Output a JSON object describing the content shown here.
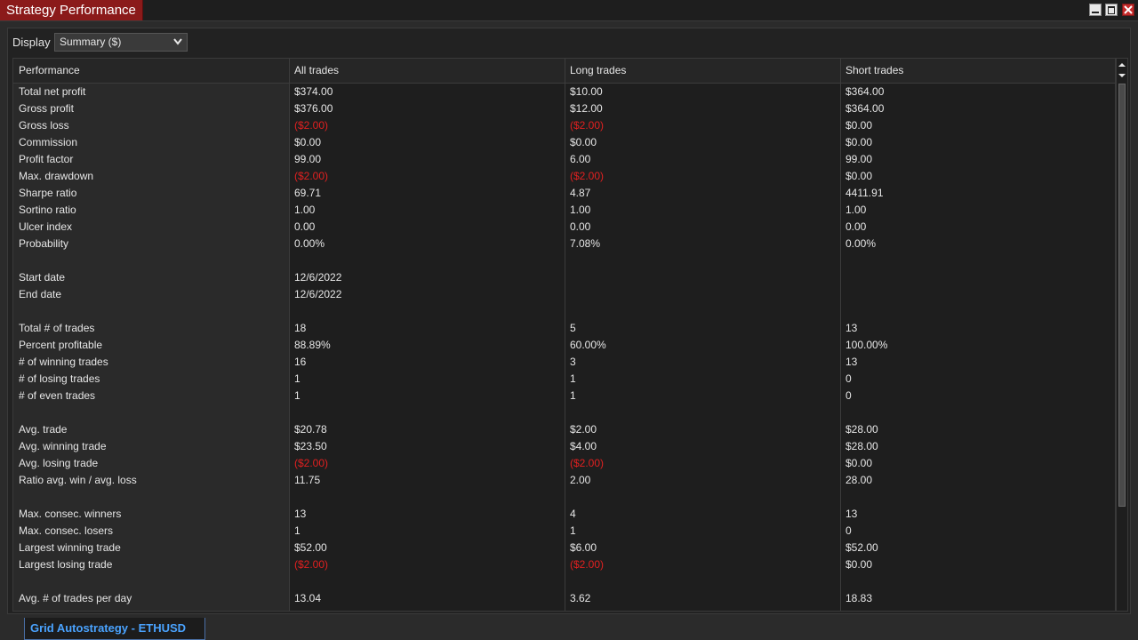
{
  "window": {
    "title": "Strategy Performance"
  },
  "display": {
    "label": "Display",
    "selected": "Summary ($)"
  },
  "columns": [
    "Performance",
    "All trades",
    "Long trades",
    "Short trades"
  ],
  "rows": [
    {
      "label": "Total net profit",
      "all": "$374.00",
      "long": "$10.00",
      "short": "$364.00",
      "neg": [
        false,
        false,
        false
      ]
    },
    {
      "label": "Gross profit",
      "all": "$376.00",
      "long": "$12.00",
      "short": "$364.00",
      "neg": [
        false,
        false,
        false
      ]
    },
    {
      "label": "Gross loss",
      "all": "($2.00)",
      "long": "($2.00)",
      "short": "$0.00",
      "neg": [
        true,
        true,
        false
      ]
    },
    {
      "label": "Commission",
      "all": "$0.00",
      "long": "$0.00",
      "short": "$0.00",
      "neg": [
        false,
        false,
        false
      ]
    },
    {
      "label": "Profit factor",
      "all": "99.00",
      "long": "6.00",
      "short": "99.00",
      "neg": [
        false,
        false,
        false
      ]
    },
    {
      "label": "Max. drawdown",
      "all": "($2.00)",
      "long": "($2.00)",
      "short": "$0.00",
      "neg": [
        true,
        true,
        false
      ]
    },
    {
      "label": "Sharpe ratio",
      "all": "69.71",
      "long": "4.87",
      "short": "4411.91",
      "neg": [
        false,
        false,
        false
      ]
    },
    {
      "label": "Sortino ratio",
      "all": "1.00",
      "long": "1.00",
      "short": "1.00",
      "neg": [
        false,
        false,
        false
      ]
    },
    {
      "label": "Ulcer index",
      "all": "0.00",
      "long": "0.00",
      "short": "0.00",
      "neg": [
        false,
        false,
        false
      ]
    },
    {
      "label": "Probability",
      "all": "0.00%",
      "long": "7.08%",
      "short": "0.00%",
      "neg": [
        false,
        false,
        false
      ]
    },
    {
      "label": "",
      "all": "",
      "long": "",
      "short": "",
      "neg": [
        false,
        false,
        false
      ]
    },
    {
      "label": "Start date",
      "all": "12/6/2022",
      "long": "",
      "short": "",
      "neg": [
        false,
        false,
        false
      ]
    },
    {
      "label": "End date",
      "all": "12/6/2022",
      "long": "",
      "short": "",
      "neg": [
        false,
        false,
        false
      ]
    },
    {
      "label": "",
      "all": "",
      "long": "",
      "short": "",
      "neg": [
        false,
        false,
        false
      ]
    },
    {
      "label": "Total # of trades",
      "all": "18",
      "long": "5",
      "short": "13",
      "neg": [
        false,
        false,
        false
      ]
    },
    {
      "label": "Percent profitable",
      "all": "88.89%",
      "long": "60.00%",
      "short": "100.00%",
      "neg": [
        false,
        false,
        false
      ]
    },
    {
      "label": "# of winning trades",
      "all": "16",
      "long": "3",
      "short": "13",
      "neg": [
        false,
        false,
        false
      ]
    },
    {
      "label": "# of losing trades",
      "all": "1",
      "long": "1",
      "short": "0",
      "neg": [
        false,
        false,
        false
      ]
    },
    {
      "label": "# of even trades",
      "all": "1",
      "long": "1",
      "short": "0",
      "neg": [
        false,
        false,
        false
      ]
    },
    {
      "label": "",
      "all": "",
      "long": "",
      "short": "",
      "neg": [
        false,
        false,
        false
      ]
    },
    {
      "label": "Avg. trade",
      "all": "$20.78",
      "long": "$2.00",
      "short": "$28.00",
      "neg": [
        false,
        false,
        false
      ]
    },
    {
      "label": "Avg. winning trade",
      "all": "$23.50",
      "long": "$4.00",
      "short": "$28.00",
      "neg": [
        false,
        false,
        false
      ]
    },
    {
      "label": "Avg. losing trade",
      "all": "($2.00)",
      "long": "($2.00)",
      "short": "$0.00",
      "neg": [
        true,
        true,
        false
      ]
    },
    {
      "label": "Ratio avg. win / avg. loss",
      "all": "11.75",
      "long": "2.00",
      "short": "28.00",
      "neg": [
        false,
        false,
        false
      ]
    },
    {
      "label": "",
      "all": "",
      "long": "",
      "short": "",
      "neg": [
        false,
        false,
        false
      ]
    },
    {
      "label": "Max. consec. winners",
      "all": "13",
      "long": "4",
      "short": "13",
      "neg": [
        false,
        false,
        false
      ]
    },
    {
      "label": "Max. consec. losers",
      "all": "1",
      "long": "1",
      "short": "0",
      "neg": [
        false,
        false,
        false
      ]
    },
    {
      "label": "Largest winning trade",
      "all": "$52.00",
      "long": "$6.00",
      "short": "$52.00",
      "neg": [
        false,
        false,
        false
      ]
    },
    {
      "label": "Largest losing trade",
      "all": "($2.00)",
      "long": "($2.00)",
      "short": "$0.00",
      "neg": [
        true,
        true,
        false
      ]
    },
    {
      "label": "",
      "all": "",
      "long": "",
      "short": "",
      "neg": [
        false,
        false,
        false
      ]
    },
    {
      "label": "Avg. # of trades per day",
      "all": "13.04",
      "long": "3.62",
      "short": "18.83",
      "neg": [
        false,
        false,
        false
      ]
    }
  ],
  "bottom_tab": {
    "label": "Grid Autostrategy - ETHUSD"
  },
  "colors": {
    "title_tab": "#8b1a1a",
    "negative": "#e02020",
    "tab_text": "#4aa3ff"
  }
}
